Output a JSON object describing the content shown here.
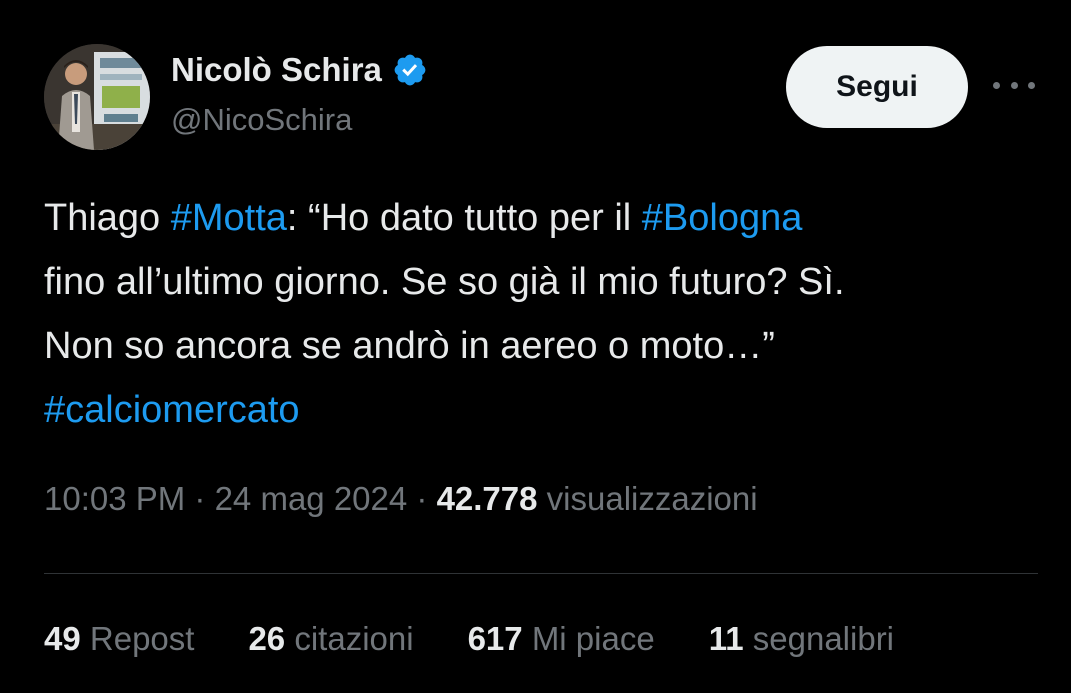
{
  "author": {
    "display_name": "Nicolò Schira",
    "handle": "@NicoSchira",
    "verified": true,
    "avatar_icon": "profile-photo"
  },
  "actions": {
    "follow_label": "Segui",
    "more_icon": "ellipsis-icon"
  },
  "tweet": {
    "lines": [
      [
        {
          "text": "Thiago ",
          "type": "text"
        },
        {
          "text": "#Motta",
          "type": "hashtag"
        },
        {
          "text": ": “Ho dato tutto per il ",
          "type": "text"
        },
        {
          "text": "#Bologna",
          "type": "hashtag"
        }
      ],
      [
        {
          "text": "fino all’ultimo giorno. Se so già il mio futuro? Sì.",
          "type": "text"
        }
      ],
      [
        {
          "text": "Non so ancora se andrò in aereo o moto…”",
          "type": "text"
        }
      ],
      [
        {
          "text": "#calciomercato",
          "type": "hashtag"
        }
      ]
    ]
  },
  "meta": {
    "time": "10:03 PM",
    "separator": " · ",
    "date": "24 mag 2024",
    "views_count": "42.778",
    "views_label": "visualizzazioni"
  },
  "stats": [
    {
      "count": "49",
      "label": "Repost"
    },
    {
      "count": "26",
      "label": "citazioni"
    },
    {
      "count": "617",
      "label": "Mi piace"
    },
    {
      "count": "11",
      "label": "segnalibri"
    }
  ],
  "colors": {
    "background": "#000000",
    "text": "#e7e9ea",
    "secondary": "#71767b",
    "accent": "#1d9bf0",
    "button_bg": "#eff3f4"
  }
}
